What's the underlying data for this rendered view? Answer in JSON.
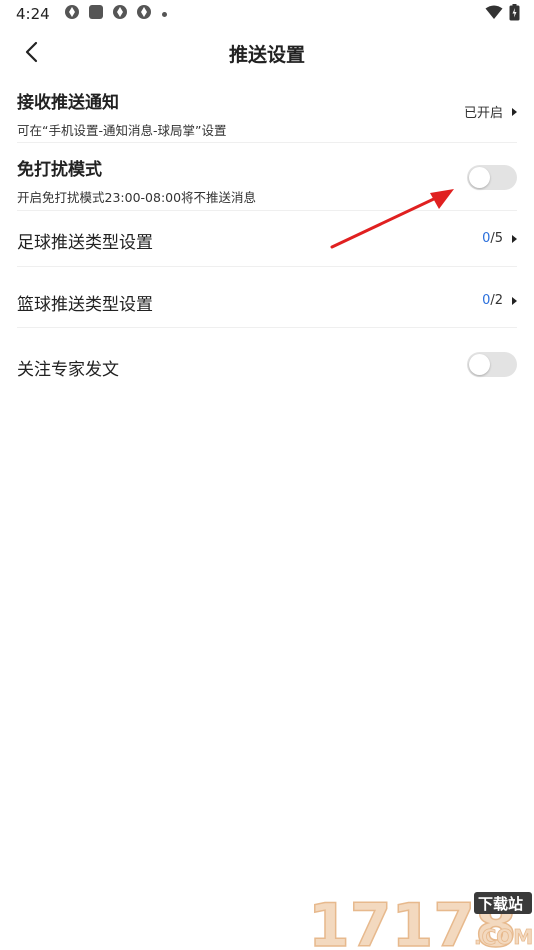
{
  "status_bar": {
    "time": "4:24",
    "icons": [
      "app-notification-icon",
      "app-notification-icon",
      "app-notification-icon",
      "app-notification-icon"
    ],
    "right_icons": [
      "wifi-icon",
      "battery-icon"
    ]
  },
  "header": {
    "title": "推送设置",
    "back_icon": "chevron-left-icon"
  },
  "settings": {
    "receive_push": {
      "title": "接收推送通知",
      "subtitle": "可在“手机设置-通知消息-球局掌”设置",
      "value": "已开启"
    },
    "dnd": {
      "title": "免打扰模式",
      "subtitle": "开启免打扰模式23:00-08:00将不推送消息",
      "enabled": false
    },
    "football": {
      "title": "足球推送类型设置",
      "selected": "0",
      "total": "/5"
    },
    "basketball": {
      "title": "篮球推送类型设置",
      "selected": "0",
      "total": "/2"
    },
    "expert": {
      "title": "关注专家发文",
      "enabled": false
    }
  },
  "annotation": {
    "color": "#e02020"
  },
  "watermark": {
    "text": "17178",
    "suffix": ".COM",
    "badge": "下载站"
  },
  "colors": {
    "accent": "#2a6fdc",
    "toggle_off": "#e3e3e3"
  }
}
